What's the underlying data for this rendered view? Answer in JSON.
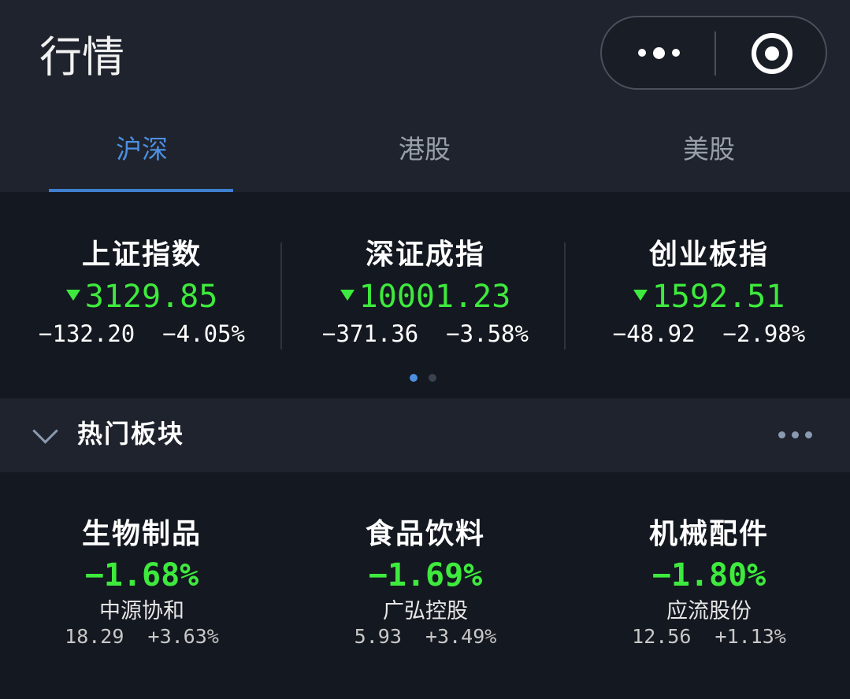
{
  "header": {
    "title": "行情"
  },
  "tabs": [
    {
      "label": "沪深",
      "active": true
    },
    {
      "label": "港股",
      "active": false
    },
    {
      "label": "美股",
      "active": false
    }
  ],
  "indices": [
    {
      "name": "上证指数",
      "price": "3129.85",
      "change": "−132.20",
      "percent": "−4.05%"
    },
    {
      "name": "深证成指",
      "price": "10001.23",
      "change": "−371.36",
      "percent": "−3.58%"
    },
    {
      "name": "创业板指",
      "price": "1592.51",
      "change": "−48.92",
      "percent": "−2.98%"
    }
  ],
  "pager": {
    "current": 1,
    "total": 2
  },
  "section": {
    "title": "热门板块"
  },
  "sectors": [
    {
      "name": "生物制品",
      "change": "−1.68%",
      "stock": "中源协和",
      "stock_price": "18.29",
      "stock_change": "+3.63%"
    },
    {
      "name": "食品饮料",
      "change": "−1.69%",
      "stock": "广弘控股",
      "stock_price": "5.93",
      "stock_change": "+3.49%"
    },
    {
      "name": "机械配件",
      "change": "−1.80%",
      "stock": "应流股份",
      "stock_price": "12.56",
      "stock_change": "+1.13%"
    }
  ],
  "colors": {
    "accent": "#4d8fe0",
    "down": "#3dea3d",
    "background": "#141820",
    "panel": "#1e232d"
  },
  "icons": {
    "capsule_more": "more-dots-icon",
    "capsule_close": "target-close-icon",
    "section_toggle": "chevron-down-icon",
    "section_more": "more-dots-icon",
    "price_down": "triangle-down-icon"
  }
}
